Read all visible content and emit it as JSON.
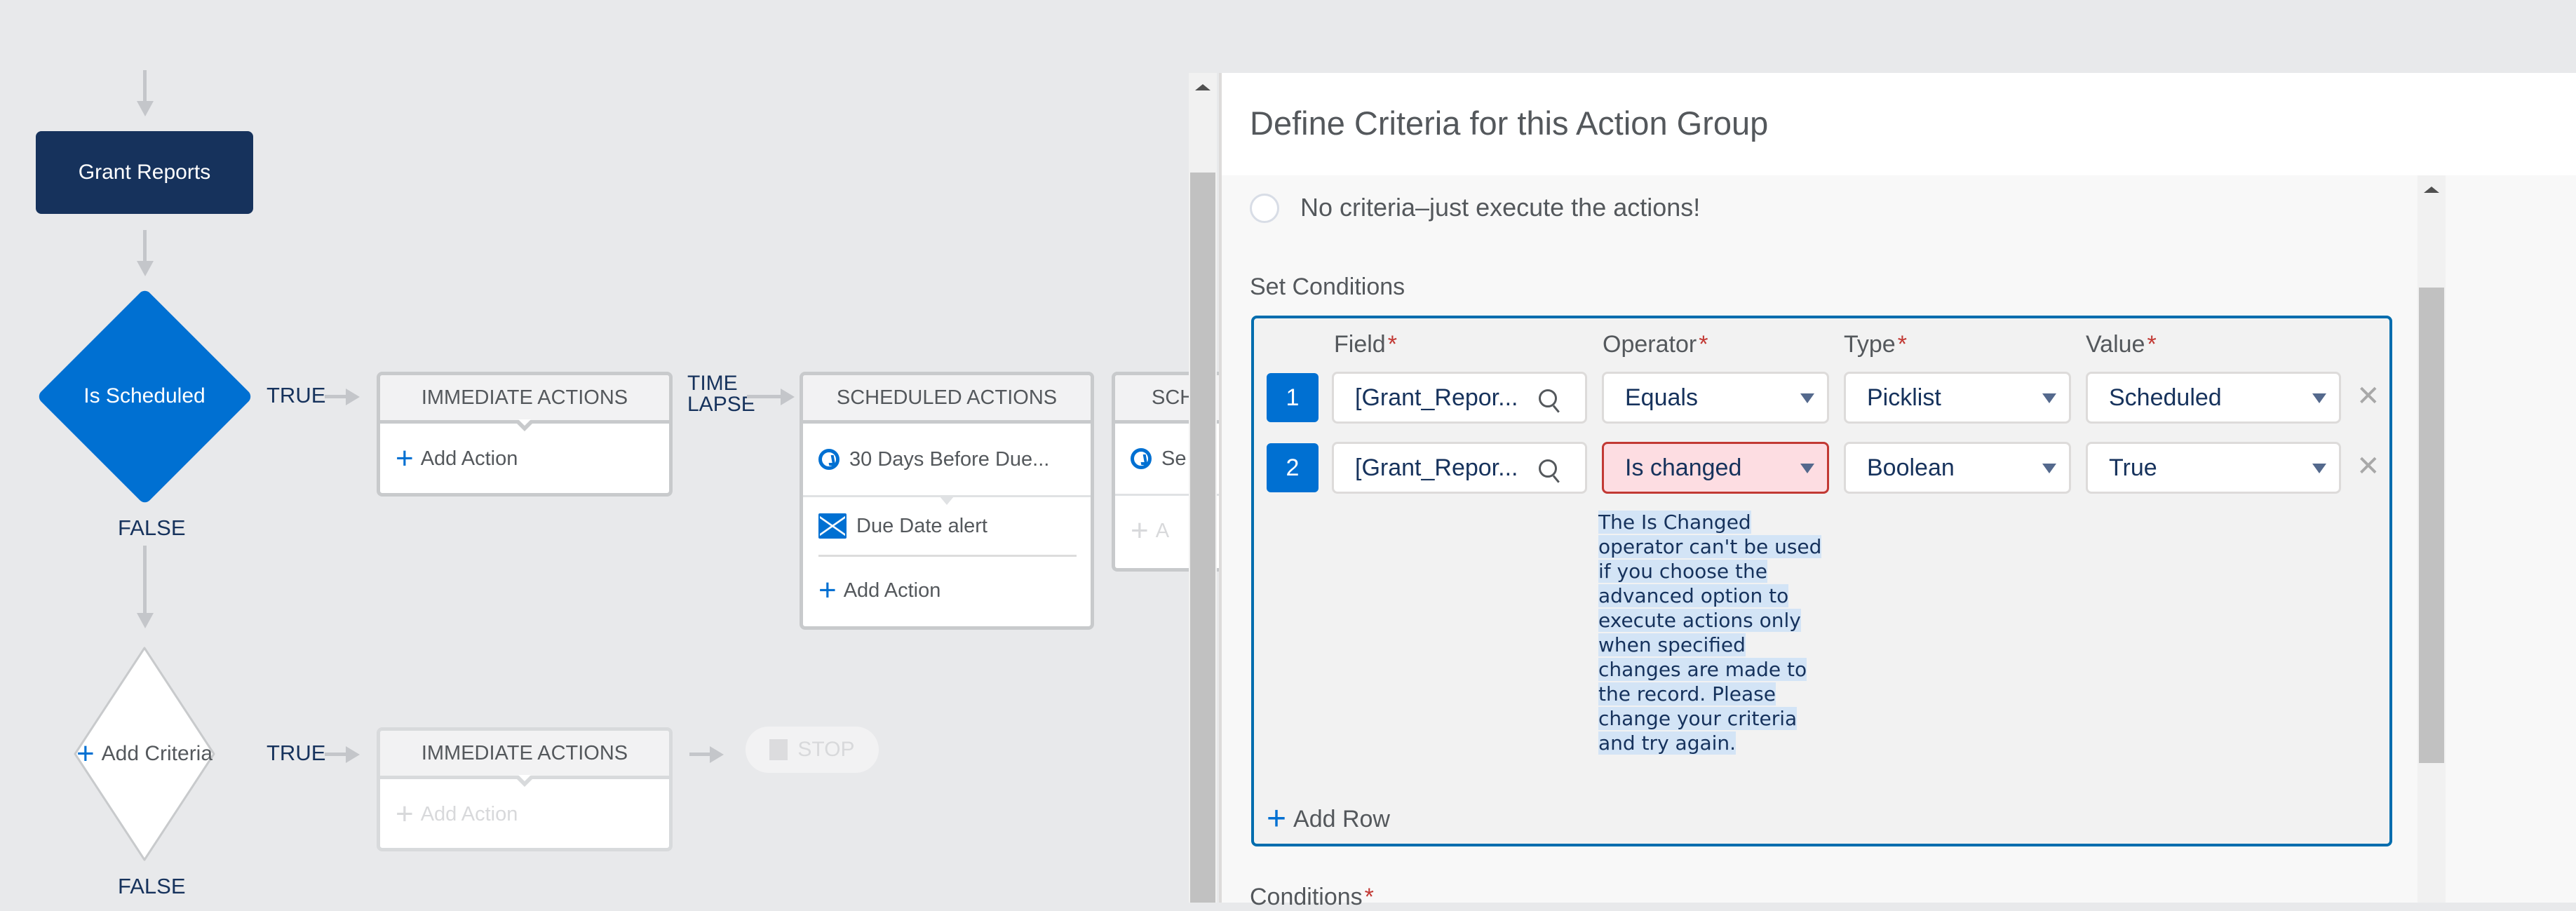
{
  "canvas": {
    "object_node": "Grant Reports",
    "criteria_nodes": [
      {
        "label": "Is Scheduled",
        "true_label": "TRUE",
        "false_label": "FALSE"
      },
      {
        "label": "Add Criteria",
        "true_label": "TRUE",
        "false_label": "FALSE"
      }
    ],
    "time_lapse_label_1": "TIME",
    "time_lapse_label_2": "LAPSE",
    "immediate_actions_card": {
      "header": "IMMEDIATE ACTIONS",
      "add_action": "Add Action"
    },
    "scheduled_actions_card": {
      "header": "SCHEDULED ACTIONS",
      "schedule": "30 Days Before Due...",
      "action": "Due Date alert",
      "add_action": "Add Action"
    },
    "scheduled_actions_card_2": {
      "header": "SCH",
      "schedule": "Se",
      "add_action": "A"
    },
    "immediate_actions_card_2": {
      "header": "IMMEDIATE ACTIONS",
      "add_action": "Add Action"
    },
    "stop_label": "STOP"
  },
  "panel": {
    "title": "Define Criteria for this Action Group",
    "no_criteria_option": "No criteria–just execute the actions!",
    "set_conditions_label": "Set Conditions",
    "columns": {
      "field": "Field",
      "operator": "Operator",
      "type": "Type",
      "value": "Value",
      "required_mark": "*"
    },
    "rows": [
      {
        "num": "1",
        "field": "[Grant_Repor...",
        "operator": "Equals",
        "type": "Picklist",
        "value": "Scheduled",
        "operator_error": false
      },
      {
        "num": "2",
        "field": "[Grant_Repor...",
        "operator": "Is changed",
        "type": "Boolean",
        "value": "True",
        "operator_error": true
      }
    ],
    "error_message": "The Is Changed operator can't be used if you choose the advanced option to execute actions only when specified changes are made to the record. Please change your criteria and try again.",
    "add_row": "Add Row",
    "conditions_label": "Conditions",
    "delete_glyph": "✕"
  },
  "colors": {
    "brand_blue": "#0070d2",
    "navy": "#16325c",
    "error_red": "#c23934",
    "error_bg": "#fddde2",
    "box_border": "#006dae"
  }
}
